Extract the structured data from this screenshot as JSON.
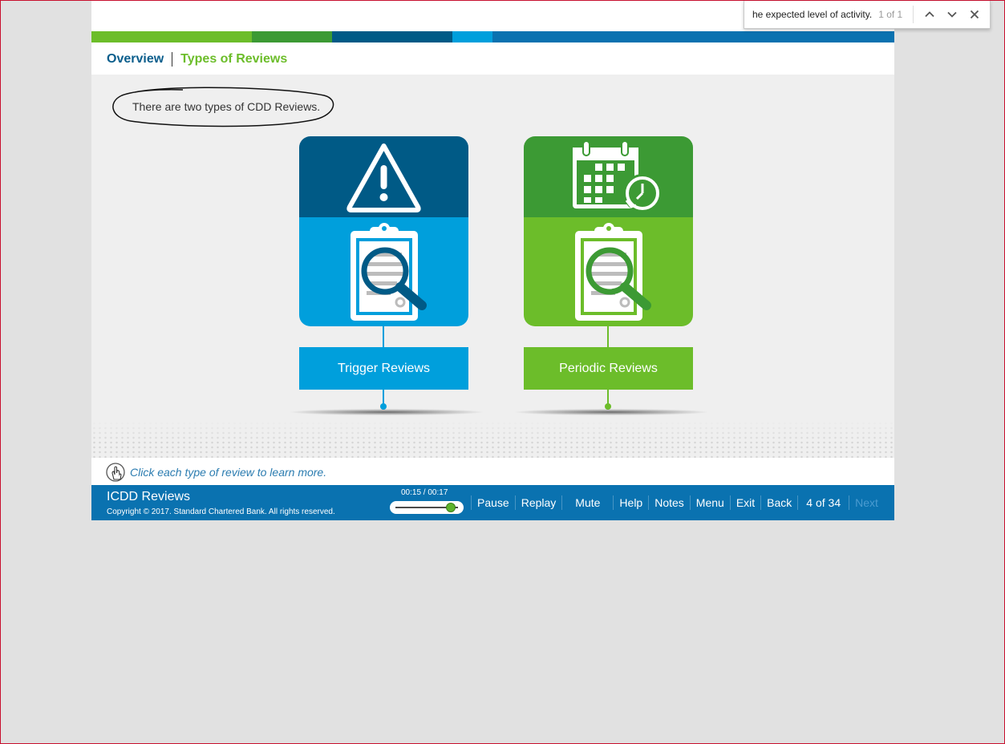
{
  "colors": {
    "dark_blue": "#005a86",
    "light_blue": "#009fdc",
    "dark_green": "#3c9a34",
    "light_green": "#6cbd2a",
    "footer_blue": "#0a72b0",
    "bar_segments": [
      "#6cbd2a",
      "#3c9a34",
      "#005a86",
      "#009fdc",
      "#0a72b0"
    ]
  },
  "breadcrumb": {
    "item1": "Overview",
    "item2": "Types of Reviews"
  },
  "intro": {
    "text": "There are two types of CDD Reviews."
  },
  "cards": [
    {
      "label": "Trigger Reviews",
      "top_icon": "warning-triangle-icon",
      "bottom_icon": "clipboard-magnifier-icon"
    },
    {
      "label": "Periodic Reviews",
      "top_icon": "calendar-clock-icon",
      "bottom_icon": "clipboard-magnifier-icon"
    }
  ],
  "hint": {
    "icon": "hand-click-icon",
    "text": "Click each type of review to learn more."
  },
  "footer": {
    "title": "ICDD Reviews",
    "copyright": "Copyright © 2017. Standard Chartered Bank. All rights reserved.",
    "time": "00:15 / 00:17",
    "progress": 0.88,
    "controls": [
      "Pause",
      "Replay",
      "Mute",
      "Help",
      "Notes",
      "Menu",
      "Exit",
      "Back"
    ],
    "page": "4 of 34",
    "next": "Next"
  },
  "findbar": {
    "query": "he expected level of activity.",
    "count": "1 of 1",
    "icons": [
      "chevron-up-icon",
      "chevron-down-icon",
      "close-icon"
    ]
  }
}
